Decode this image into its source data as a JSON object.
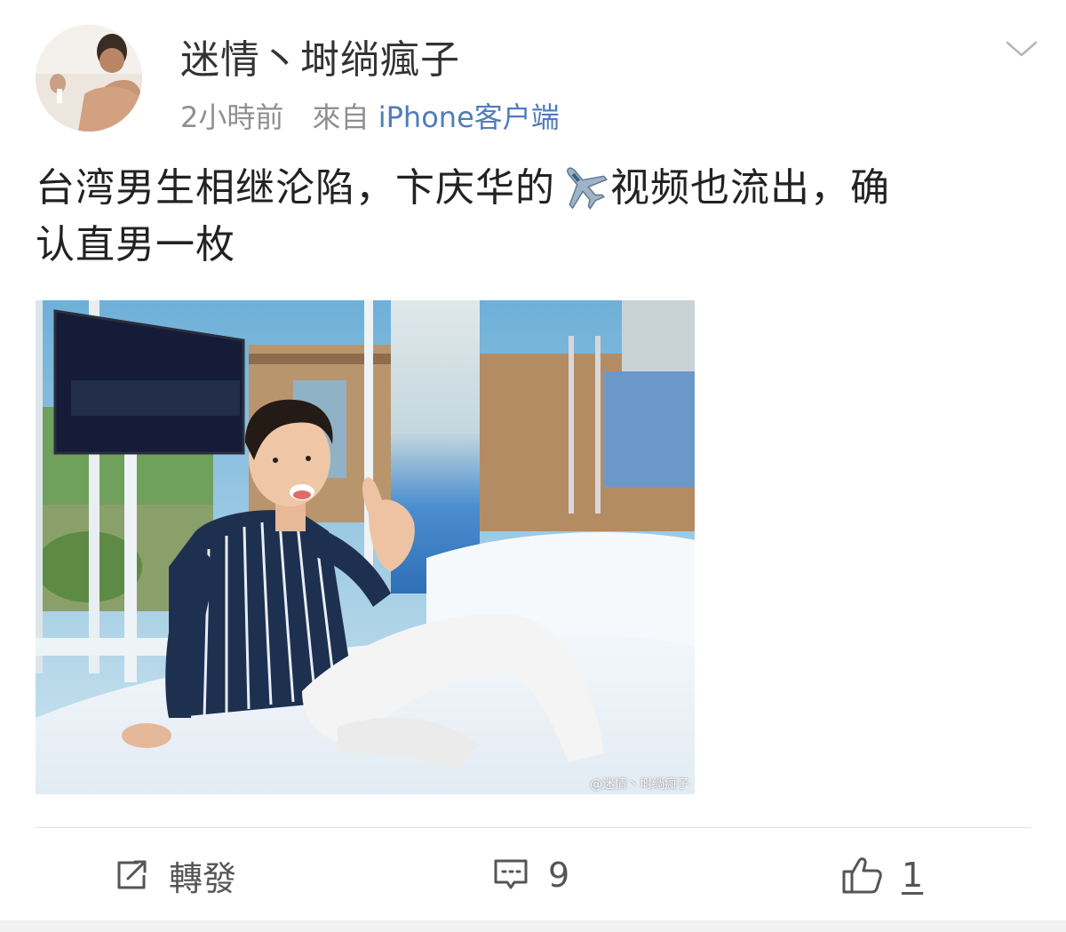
{
  "post": {
    "author": {
      "username": "迷情丶埘绱瘋子",
      "avatar_icon": "avatar-photo"
    },
    "meta": {
      "time": "2小時前",
      "source_prefix": "來自",
      "source_link": "iPhone客户端"
    },
    "text": {
      "line1_before_emoji": "台湾男生相继沦陷，卞庆华的",
      "emoji": "airplane-emoji",
      "line1_after_emoji": "视频也流出，确",
      "line2": "认直男一枚"
    },
    "image": {
      "watermark": "@迷情丶埘绱瘋子"
    },
    "actions": {
      "repost_label": "轉發",
      "comment_count": "9",
      "like_count": "1"
    }
  },
  "colors": {
    "link": "#4f7db8",
    "meta_gray": "#8f8f8f",
    "text": "#222222",
    "divider": "#e2e2e2"
  }
}
